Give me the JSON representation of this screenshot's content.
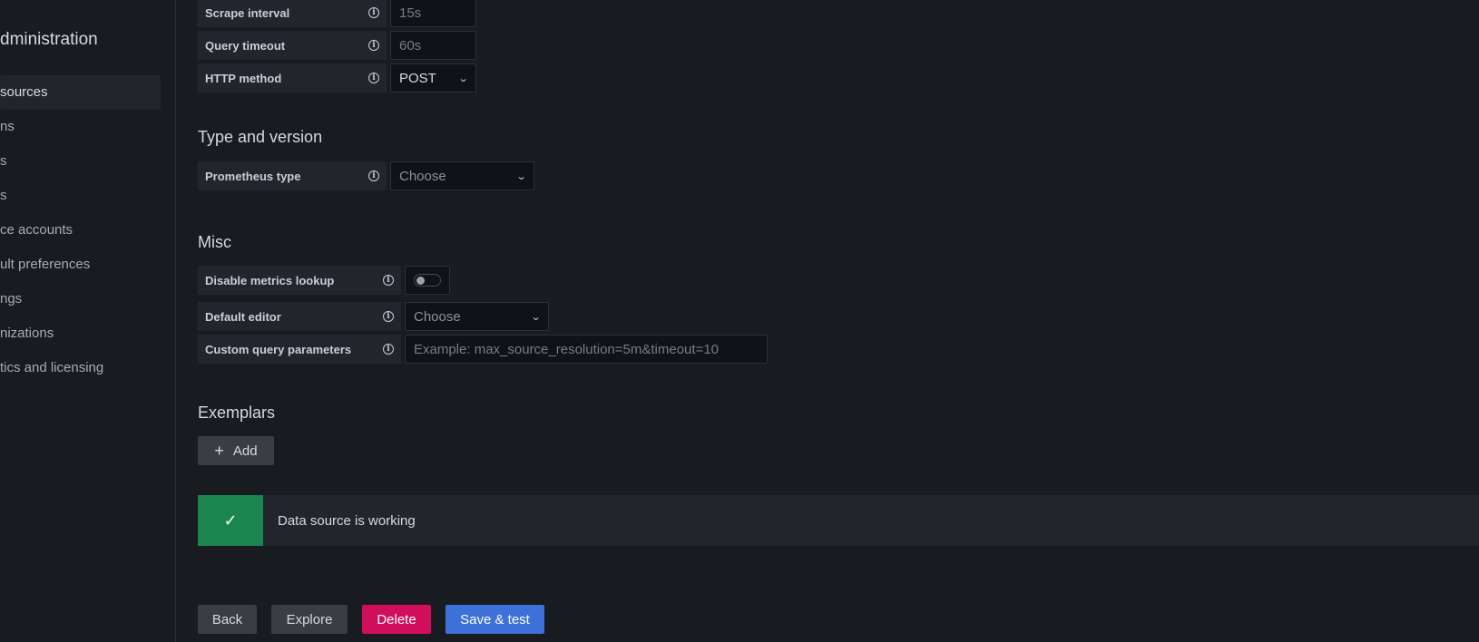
{
  "sidebar": {
    "title": "dministration",
    "items": [
      {
        "label": "sources",
        "active": true
      },
      {
        "label": "ns"
      },
      {
        "label": "s"
      },
      {
        "label": "s"
      },
      {
        "label": "ce accounts"
      },
      {
        "label": "ult preferences"
      },
      {
        "label": "ngs"
      },
      {
        "label": "nizations"
      },
      {
        "label": "tics and licensing"
      }
    ]
  },
  "http": {
    "scrape_interval": {
      "label": "Scrape interval",
      "placeholder": "15s"
    },
    "query_timeout": {
      "label": "Query timeout",
      "placeholder": "60s"
    },
    "http_method": {
      "label": "HTTP method",
      "value": "POST"
    }
  },
  "type_version": {
    "title": "Type and version",
    "prometheus_type": {
      "label": "Prometheus type",
      "value": "Choose"
    }
  },
  "misc": {
    "title": "Misc",
    "disable_metrics_lookup": {
      "label": "Disable metrics lookup",
      "enabled": false
    },
    "default_editor": {
      "label": "Default editor",
      "value": "Choose"
    },
    "custom_query_parameters": {
      "label": "Custom query parameters",
      "placeholder": "Example: max_source_resolution=5m&timeout=10"
    }
  },
  "exemplars": {
    "title": "Exemplars",
    "add_label": "Add"
  },
  "alert": {
    "message": "Data source is working",
    "color": "#1b8550"
  },
  "actions": {
    "back": "Back",
    "explore": "Explore",
    "delete": "Delete",
    "save_test": "Save & test"
  },
  "icons": {
    "info": "info-circle-icon",
    "chevron": "chevron-down-icon",
    "check": "check-icon",
    "plus": "plus-icon"
  }
}
